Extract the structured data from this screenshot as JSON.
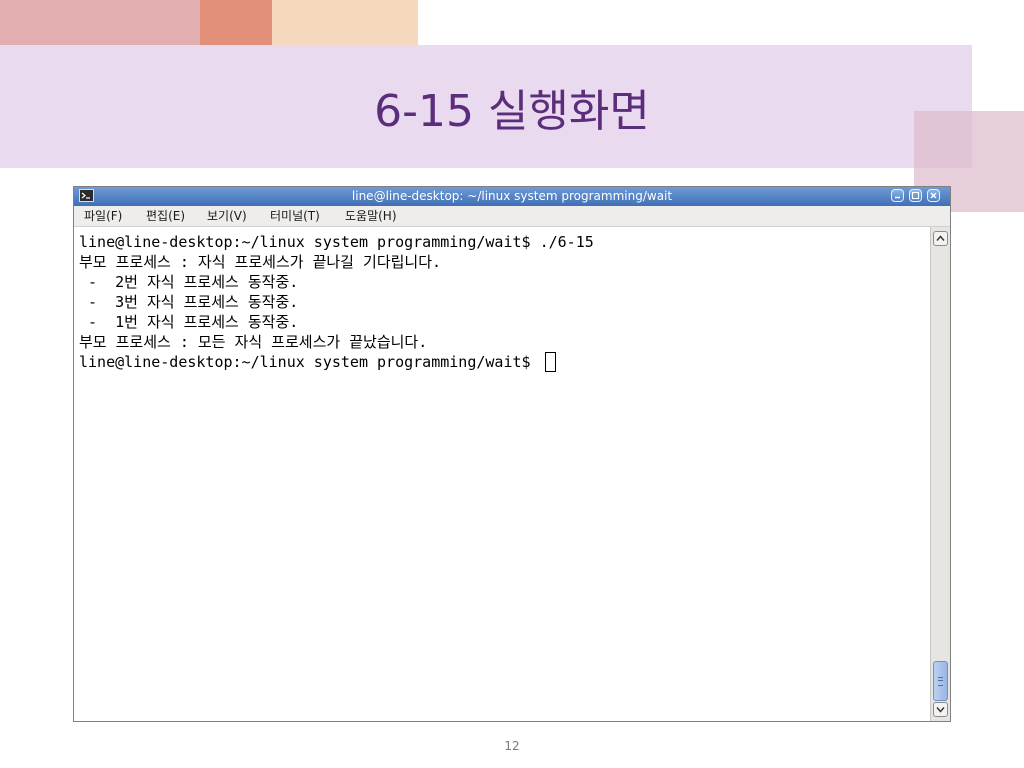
{
  "slide": {
    "title": "6-15 실행화면",
    "page_number": "12"
  },
  "window": {
    "title": "line@line-desktop: ~/linux system programming/wait",
    "icons": {
      "app": "terminal-icon",
      "minimize": "minimize-icon",
      "maximize": "maximize-icon",
      "close": "close-icon"
    }
  },
  "menu": {
    "items": [
      {
        "label": "파일(F)"
      },
      {
        "label": "편집(E)"
      },
      {
        "label": "보기(V)"
      },
      {
        "label": "터미널(T)"
      },
      {
        "label": "도움말(H)"
      }
    ]
  },
  "terminal": {
    "lines": [
      "line@line-desktop:~/linux system programming/wait$ ./6-15",
      "부모 프로세스 : 자식 프로세스가 끝나길 기다립니다.",
      " -  2번 자식 프로세스 동작중.",
      " -  3번 자식 프로세스 동작중.",
      " -  1번 자식 프로세스 동작중.",
      "부모 프로세스 : 모든 자식 프로세스가 끝났습니다.",
      "line@line-desktop:~/linux system programming/wait$ "
    ]
  },
  "colors": {
    "title_text": "#5b2d7a",
    "title_band": "#e9daf0",
    "titlebar": "#4f7fc4"
  }
}
